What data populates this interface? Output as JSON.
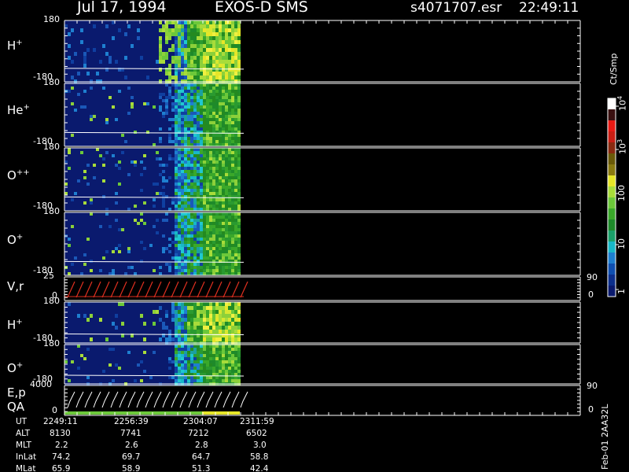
{
  "header": {
    "date": "Jul 17, 1994",
    "instrument": "EXOS-D SMS",
    "file": "s4071707.esr",
    "time": "22:49:11"
  },
  "chart_data": {
    "type": "heatmap",
    "title": "Jul 17, 1994   EXOS-D SMS",
    "panels": [
      {
        "name": "H+",
        "species_base": "H",
        "species_sup": "+",
        "ymax": "180",
        "ymin": "-180",
        "kind": "spectrogram"
      },
      {
        "name": "He+",
        "species_base": "He",
        "species_sup": "+",
        "ymax": "180",
        "ymin": "-180",
        "kind": "spectrogram"
      },
      {
        "name": "O++",
        "species_base": "O",
        "species_sup": "++",
        "ymax": "180",
        "ymin": "-180",
        "kind": "spectrogram"
      },
      {
        "name": "O+",
        "species_base": "O",
        "species_sup": "+",
        "ymax": "180",
        "ymin": "-180",
        "kind": "spectrogram"
      },
      {
        "name": "V,r",
        "ymax": "25",
        "ymin": "0",
        "right_max": "90",
        "right_min": "0",
        "kind": "line"
      },
      {
        "name": "H+",
        "species_base": "H",
        "species_sup": "+",
        "ymax": "180",
        "ymin": "-180",
        "kind": "spectrogram"
      },
      {
        "name": "O+",
        "species_base": "O",
        "species_sup": "+",
        "ymax": "180",
        "ymin": "-180",
        "kind": "spectrogram"
      },
      {
        "name": "E,p / QA",
        "label1": "E,p",
        "label2": "QA",
        "ymax": "4000",
        "ymin": "0",
        "right_max": "90",
        "right_min": "0",
        "kind": "line"
      }
    ],
    "colorbar": {
      "label": "Ct/Smp",
      "ticks": [
        {
          "base": "10",
          "exp": "4",
          "value": 10000
        },
        {
          "base": "10",
          "exp": "3",
          "value": 1000
        },
        {
          "base": "100",
          "exp": "",
          "value": 100
        },
        {
          "base": "10",
          "exp": "",
          "value": 10
        },
        {
          "base": "1",
          "exp": "",
          "value": 1
        }
      ],
      "scale": "log",
      "colors": [
        "#0a1a6e",
        "#0c2f8c",
        "#0f4fb0",
        "#1e7fd0",
        "#18b8c8",
        "#1aa06a",
        "#1e8a2a",
        "#3aa82a",
        "#6cc83a",
        "#a8dc3a",
        "#e6e628",
        "#8a7a10",
        "#6a5a08",
        "#8a2a10",
        "#c81e14",
        "#e81a14",
        "#3a1010",
        "#fff"
      ]
    },
    "footer": {
      "labels": [
        "UT",
        "ALT",
        "MLT",
        "InLat",
        "MLat"
      ],
      "columns": [
        [
          "2249:11",
          "8130",
          "2.2",
          "74.2",
          "65.9"
        ],
        [
          "2256:39",
          "7741",
          "2.6",
          "69.7",
          "58.9"
        ],
        [
          "2304:07",
          "7212",
          "2.8",
          "64.7",
          "51.3"
        ],
        [
          "2311:59",
          "6502",
          "3.0",
          "58.8",
          "42.4"
        ]
      ]
    },
    "side_label": "Feb-01 2AA32L"
  }
}
